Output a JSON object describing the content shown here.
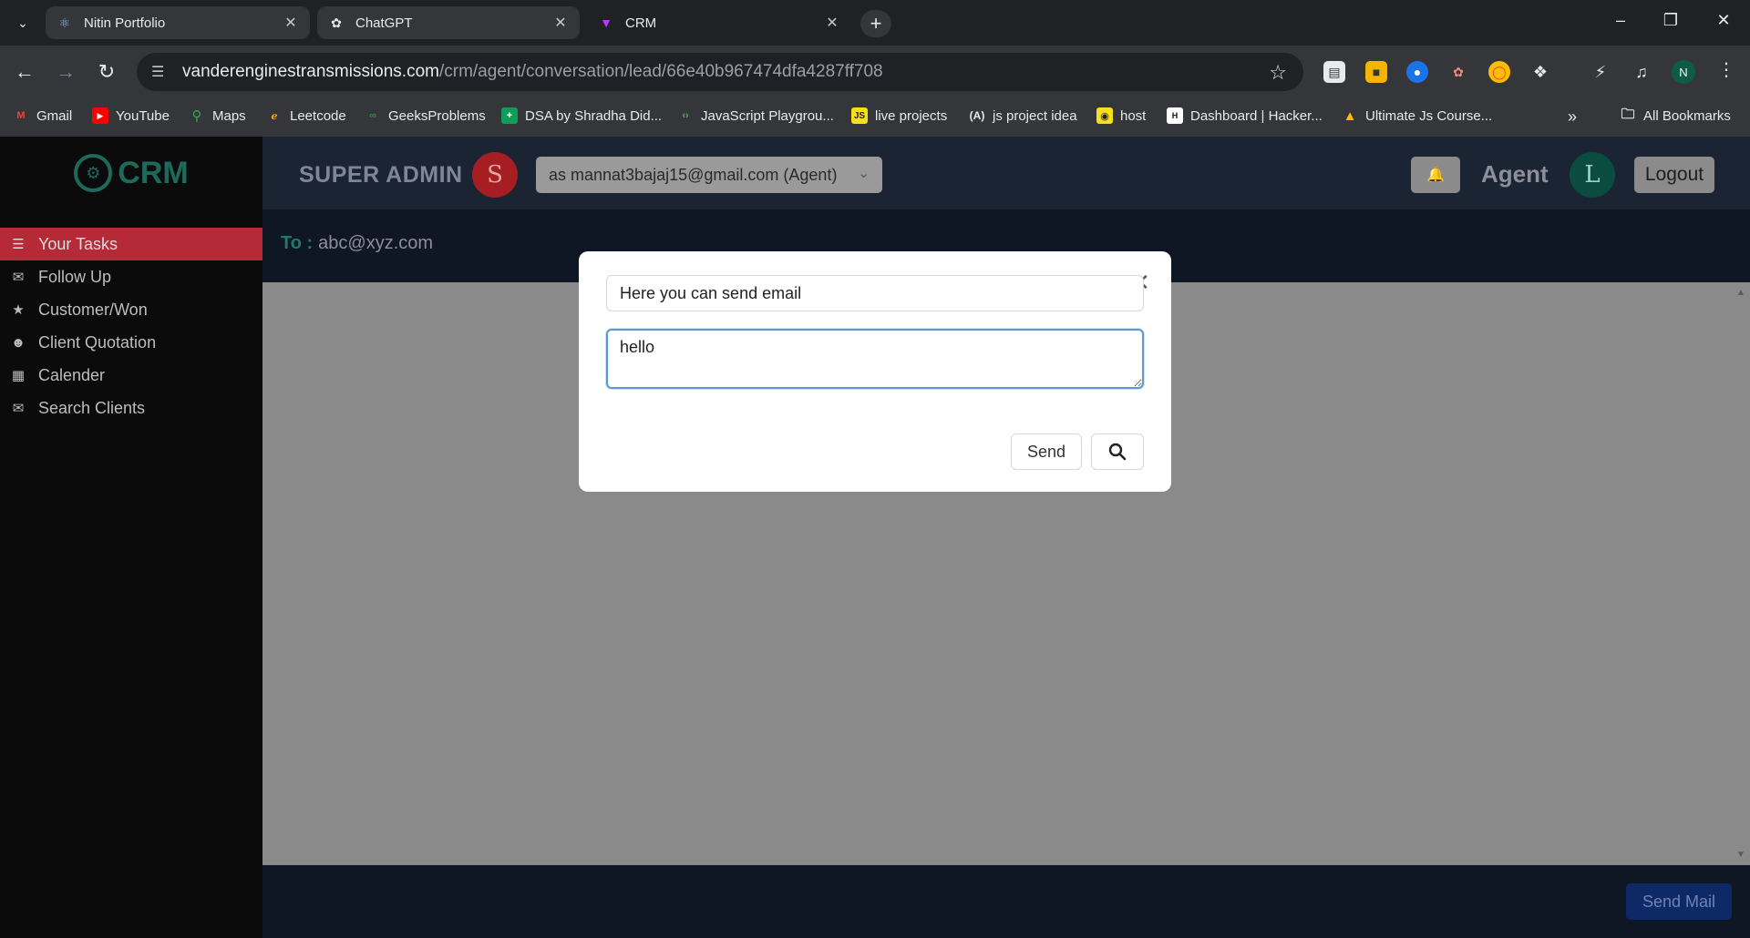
{
  "browser": {
    "tabs": [
      {
        "label": "Nitin Portfolio",
        "icon": "react-icon"
      },
      {
        "label": "ChatGPT",
        "icon": "openai-icon"
      },
      {
        "label": "CRM",
        "icon": "vite-icon",
        "active": true
      }
    ],
    "url_host": "vanderenginestransmissions.com",
    "url_path": "/crm/agent/conversation/lead/66e40b967474dfa4287ff708",
    "profile_initial": "N",
    "bookmarks": [
      {
        "label": "Gmail",
        "icon": "gmail-icon",
        "color": "#ea4335"
      },
      {
        "label": "YouTube",
        "icon": "youtube-icon",
        "color": "#ff0000"
      },
      {
        "label": "Maps",
        "icon": "maps-icon",
        "color": "#34a853"
      },
      {
        "label": "Leetcode",
        "icon": "leetcode-icon",
        "color": "#f89f1b"
      },
      {
        "label": "GeeksProblems",
        "icon": "gfg-icon",
        "color": "#2f8d46"
      },
      {
        "label": "DSA by Shradha Did...",
        "icon": "sheets-icon",
        "color": "#0f9d58"
      },
      {
        "label": "JavaScript Playgrou...",
        "icon": "code-icon",
        "color": "#4caf50"
      },
      {
        "label": "live projects",
        "icon": "js-icon",
        "color": "#f7df1e"
      },
      {
        "label": "js project idea",
        "icon": "angular-icon",
        "color": "#ffffff"
      },
      {
        "label": "host",
        "icon": "host-icon",
        "color": "#f7df1e"
      },
      {
        "label": "Dashboard | Hacker...",
        "icon": "hackerrank-icon",
        "color": "#ffffff"
      },
      {
        "label": "Ultimate Js Course...",
        "icon": "drive-icon",
        "color": "#fbbc04"
      }
    ],
    "all_bookmarks_label": "All Bookmarks"
  },
  "app": {
    "logo_text": "CRM",
    "sidebar": [
      {
        "label": "Your Tasks",
        "icon": "tasks-icon",
        "active": true
      },
      {
        "label": "Follow Up",
        "icon": "envelope-icon"
      },
      {
        "label": "Customer/Won",
        "icon": "star-icon"
      },
      {
        "label": "Client Quotation",
        "icon": "user-icon"
      },
      {
        "label": "Calender",
        "icon": "calendar-icon"
      },
      {
        "label": "Search Clients",
        "icon": "envelope-icon"
      }
    ],
    "topbar": {
      "role_title": "SUPER ADMIN",
      "admin_initial": "S",
      "agent_select_value": "as mannat3bajaj15@gmail.com (Agent)",
      "agent_label": "Agent",
      "agent_initial": "L",
      "logout_label": "Logout"
    },
    "to_label": "To :",
    "to_value": "abc@xyz.com",
    "send_mail_label": "Send Mail"
  },
  "modal": {
    "subject_value": "Here you can send email",
    "body_value": "hello",
    "send_label": "Send"
  },
  "colors": {
    "sidebar_active": "#b52a36",
    "brand": "#1d6a5c",
    "send_mail_button": "#0e2a66"
  }
}
